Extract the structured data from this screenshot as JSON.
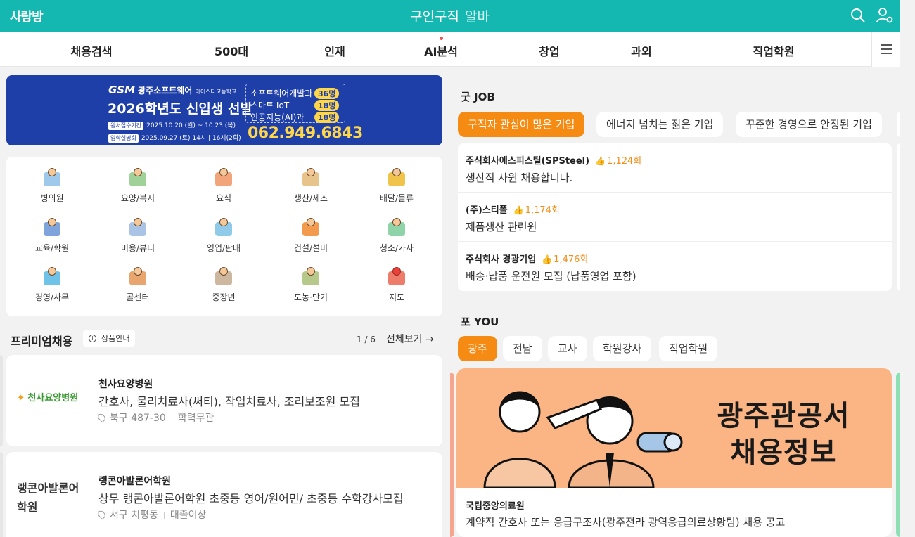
{
  "header": {
    "logo": "사랑방",
    "title_main": "구인구직",
    "title_sub": "알바",
    "search_icon": "search-icon",
    "user_icon": "user-settings-icon"
  },
  "nav": {
    "items": [
      "채용검색",
      "500대",
      "인재",
      "AI분석",
      "창업",
      "과외",
      "직업학원"
    ],
    "menu_icon": "hamburger-menu-icon"
  },
  "banner": {
    "school": "광주소프트웨어",
    "school_sub": "마이스터고등학교",
    "gsm": "GSM",
    "headline": "2026학년도 신입생 선발",
    "date1_tag": "원서접수기간",
    "date1": "2025.10.20 (월) ~ 10.23 (목)",
    "date2_tag": "입학설명회",
    "date2": "2025.09.27 (토) 14시 | 16시(2회)",
    "programs": [
      {
        "label": "소프트웨어개발과",
        "count": "36명"
      },
      {
        "label": "스마트 IoT",
        "count": "18명"
      },
      {
        "label": "인공지능(AI)과",
        "count": "18명"
      }
    ],
    "phone": "062.949.6843"
  },
  "categories": [
    {
      "label": "병의원",
      "icon": "hospital-icon",
      "color": "#e9f3fb"
    },
    {
      "label": "요양/복지",
      "icon": "caregiver-icon",
      "color": "#e7f2e6"
    },
    {
      "label": "요식",
      "icon": "chef-icon",
      "color": "#fbe4d8"
    },
    {
      "label": "생산/제조",
      "icon": "factory-icon",
      "color": "#f6ead6"
    },
    {
      "label": "배달/물류",
      "icon": "delivery-icon",
      "color": "#f7e1a8"
    },
    {
      "label": "교육/학원",
      "icon": "teacher-icon",
      "color": "#dfe8f6"
    },
    {
      "label": "미용/뷰티",
      "icon": "beauty-icon",
      "color": "#e6eef6"
    },
    {
      "label": "영업/판매",
      "icon": "sales-icon",
      "color": "#dceffa"
    },
    {
      "label": "건설/설비",
      "icon": "construction-icon",
      "color": "#fbe0c8"
    },
    {
      "label": "청소/가사",
      "icon": "cleaning-icon",
      "color": "#e2f3e8"
    },
    {
      "label": "경영/사무",
      "icon": "office-icon",
      "color": "#d9eef8"
    },
    {
      "label": "콜센터",
      "icon": "call-center-icon",
      "color": "#f7e4d2"
    },
    {
      "label": "중장년",
      "icon": "seniors-icon",
      "color": "#efe6dc"
    },
    {
      "label": "도농·단기",
      "icon": "farmer-icon",
      "color": "#e8eed8"
    },
    {
      "label": "지도",
      "icon": "map-icon",
      "color": "#fbdcd8"
    }
  ],
  "premium": {
    "title": "프리미엄채용",
    "guide": "상품안내",
    "page": "1 / 6",
    "view_all": "전체보기 →",
    "items": [
      {
        "logo": "천사요양병원",
        "name": "천사요양병원",
        "desc": "간호사, 물리치료사(써티), 작업치료사, 조리보조원 모집",
        "location": "북구 487-30",
        "education": "학력무관"
      },
      {
        "logo": "랭콘아발론어학원",
        "name": "랭콘아발론어학원",
        "desc": "상무 랭콘아발론어학원 초중등 영어/원어민/ 초중등 수학강사모집",
        "location": "서구 치평동",
        "education": "대졸이상"
      }
    ]
  },
  "goodjob": {
    "title": "굿 JOB",
    "chips": [
      "구직자 관심이 많은 기업",
      "에너지 넘치는 젊은 기업",
      "꾸준한 경영으로 안정된 기업"
    ],
    "list": [
      {
        "company": "주식회사에스피스틸(SPSteel)",
        "views": "1,124회",
        "title": "생산직 사원 채용합니다."
      },
      {
        "company": "(주)스티폴",
        "views": "1,174회",
        "title": "제품생산 관련원"
      },
      {
        "company": "주식회사 경광기업",
        "views": "1,476회",
        "title": "배송·납품 운전원 모집 (납품영업 포함)"
      }
    ]
  },
  "foryou": {
    "title": "포 YOU",
    "chips": [
      "광주",
      "전남",
      "교사",
      "학원강사",
      "직업학원"
    ],
    "card": {
      "headline_line1": "광주관공서",
      "headline_line2": "채용정보",
      "name": "국립중앙의료원",
      "desc": "계약직 간호사 또는 응급구조사(광주전라 광역응급의료상황팀) 채용 공고"
    }
  },
  "colors": {
    "brand": "#14b8b0",
    "accent": "#f58b13",
    "banner_bg": "#1e3ea8",
    "you_bg": "#fbb483"
  }
}
